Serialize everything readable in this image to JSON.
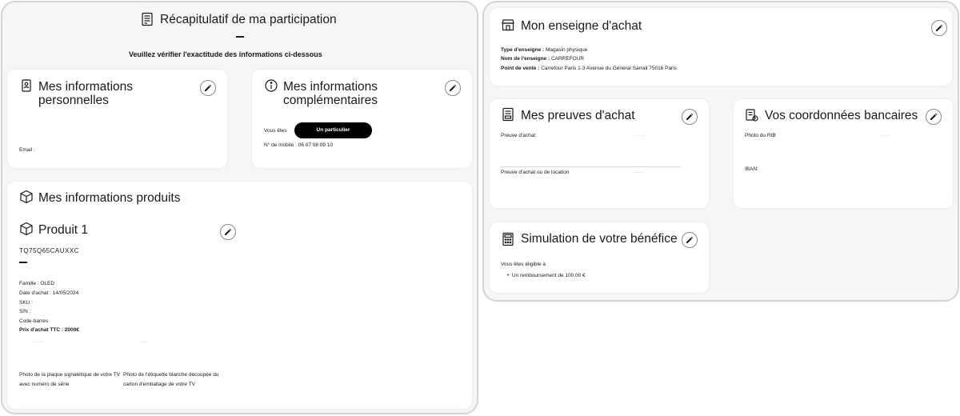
{
  "summary": {
    "title": "Récapitulatif de ma participation",
    "subtitle": "Veuillez vérifier l'exactitude des informations ci-dessous"
  },
  "personal": {
    "title_line1": "Mes informations",
    "title_line2": "personnelles",
    "email_label": "Email :"
  },
  "complementary": {
    "title_line1": "Mes informations",
    "title_line2": "complémentaires",
    "vous_etes_label": "Vous êtes",
    "vous_etes_value": "Un particulier",
    "mobile": "N° de mobile : 06 07 08 09 10"
  },
  "products": {
    "title": "Mes informations produits",
    "product_title": "Produit 1",
    "model": "TQ75Q65CAUXXC",
    "famille": "Famille : OLED",
    "date_achat": "Date d'achat : 14/05/2024",
    "sku": "SKU :",
    "sn": "S/N :",
    "code_barres": "Code-barres",
    "prix": "Prix d'achat TTC : 2000€",
    "placeholder_dots": "......",
    "photo_plaque_line1": "Photo de la plaque signalétique de votre TV",
    "photo_plaque_line2": "avec numéro de série",
    "photo_etiquette_line1": "Photo de l'étiquette blanche découpée du",
    "photo_etiquette_line2": "carton d'emballage de votre TV"
  },
  "store": {
    "title": "Mon enseigne d'achat",
    "type_label": "Type d'enseigne :",
    "type_value": "Magasin physique",
    "nom_label": "Nom de l'enseigne :",
    "nom_value": "CARREFOUR",
    "point_label": "Point de vente :",
    "point_value": "Carrefour Paris 1-3 Avenue du Général Sarrail 75016 Paris"
  },
  "proofs": {
    "title": "Mes preuves d'achat",
    "preuve_achat": "Preuve d'achat",
    "preuve_location": "Preuve d'achat ou de location",
    "placeholder_dots": "......"
  },
  "bank": {
    "title": "Vos coordonnées bancaires",
    "photo_rib": "Photo du RIB",
    "iban": "IBAN:",
    "placeholder_dots": "......"
  },
  "simulation": {
    "title": "Simulation de votre bénéfice",
    "eligible": "Vous êtes éligible à",
    "remboursement": "Un remboursement de 100.00 €"
  },
  "colors": {
    "panel_bg": "#f6f6f6",
    "card_bg": "#ffffff",
    "accent": "#000000",
    "border": "#d4d4d4"
  },
  "icons": {
    "summary": "document-list-icon",
    "personal": "id-badge-icon",
    "complementary": "info-person-icon",
    "products": "box-icon",
    "product": "box-icon",
    "store": "storefront-icon",
    "proofs": "receipt-icon",
    "bank": "bank-card-icon",
    "simulation": "calculator-icon",
    "edit": "pencil-icon"
  }
}
